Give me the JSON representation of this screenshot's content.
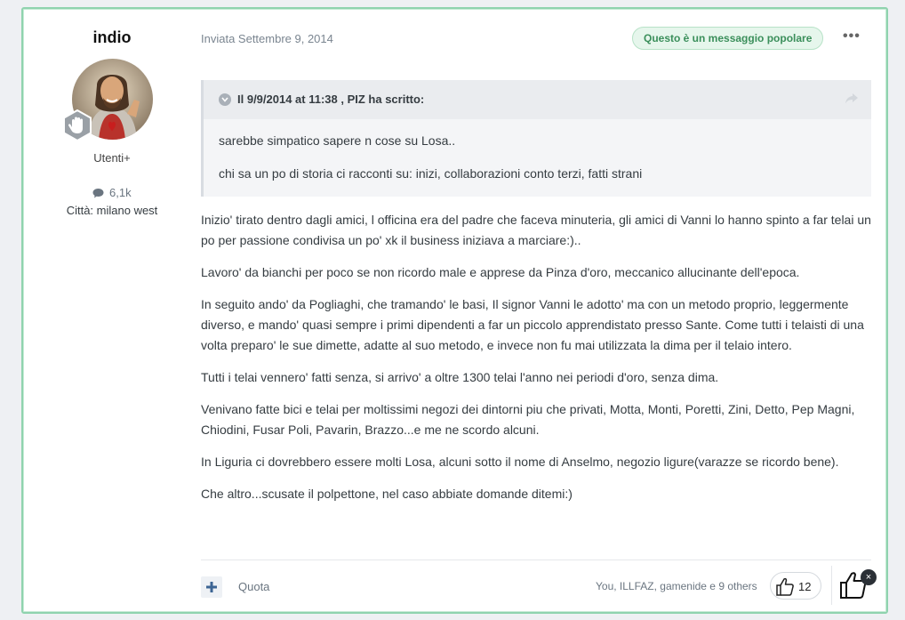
{
  "author": {
    "name": "indio",
    "group": "Utenti+",
    "post_count": "6,1k",
    "city_label": "Città: milano west"
  },
  "post": {
    "posted": "Inviata Settembre 9, 2014",
    "popular_badge": "Questo è un messaggio popolare",
    "more_menu": "•••",
    "quote": {
      "citation": "Il 9/9/2014 at 11:38 , PIZ ha scritto:",
      "paragraphs": [
        "sarebbe simpatico sapere n cose su Losa..",
        "chi sa un po di storia ci racconti su: inizi, collaborazioni conto terzi, fatti strani"
      ]
    },
    "paragraphs": [
      "Inizio' tirato dentro dagli amici, l officina era del padre che faceva minuteria, gli amici di Vanni lo hanno spinto a far telai un po per passione condivisa un po' xk il business iniziava a marciare:)..",
      "Lavoro' da bianchi per poco se non ricordo male e apprese da Pinza d'oro, meccanico allucinante dell'epoca.",
      "In seguito ando' da Pogliaghi, che tramando' le basi, Il signor Vanni le adotto' ma con un metodo proprio, leggermente diverso, e mando' quasi sempre i primi dipendenti a far un piccolo apprendistato presso Sante. Come tutti i telaisti di una volta preparo' le sue dimette, adatte al suo metodo, e invece non fu mai utilizzata la dima per il telaio intero.",
      "Tutti i telai vennero' fatti senza, si arrivo' a oltre 1300 telai l'anno nei periodi d'oro, senza dima.",
      "Venivano fatte bici e telai per moltissimi negozi dei dintorni piu che privati, Motta, Monti, Poretti, Zini, Detto, Pep Magni, Chiodini, Fusar Poli, Pavarin, Brazzo...e me ne scordo alcuni.",
      "In Liguria ci dovrebbero essere molti Losa, alcuni sotto il nome di Anselmo, negozio ligure(varazze se ricordo bene).",
      "Che altro...scusate il polpettone, nel caso abbiate domande ditemi:)"
    ]
  },
  "footer": {
    "quote_label": "Quota",
    "reactors": "You, ILLFAZ, gamenide e 9 others",
    "reaction_count": "12",
    "remove_label": "×"
  },
  "colors": {
    "accent": "#8fd3ae",
    "popular_text": "#3b8f5b",
    "popular_bg": "#e6f6ec",
    "multiquote": "#3d6594"
  }
}
